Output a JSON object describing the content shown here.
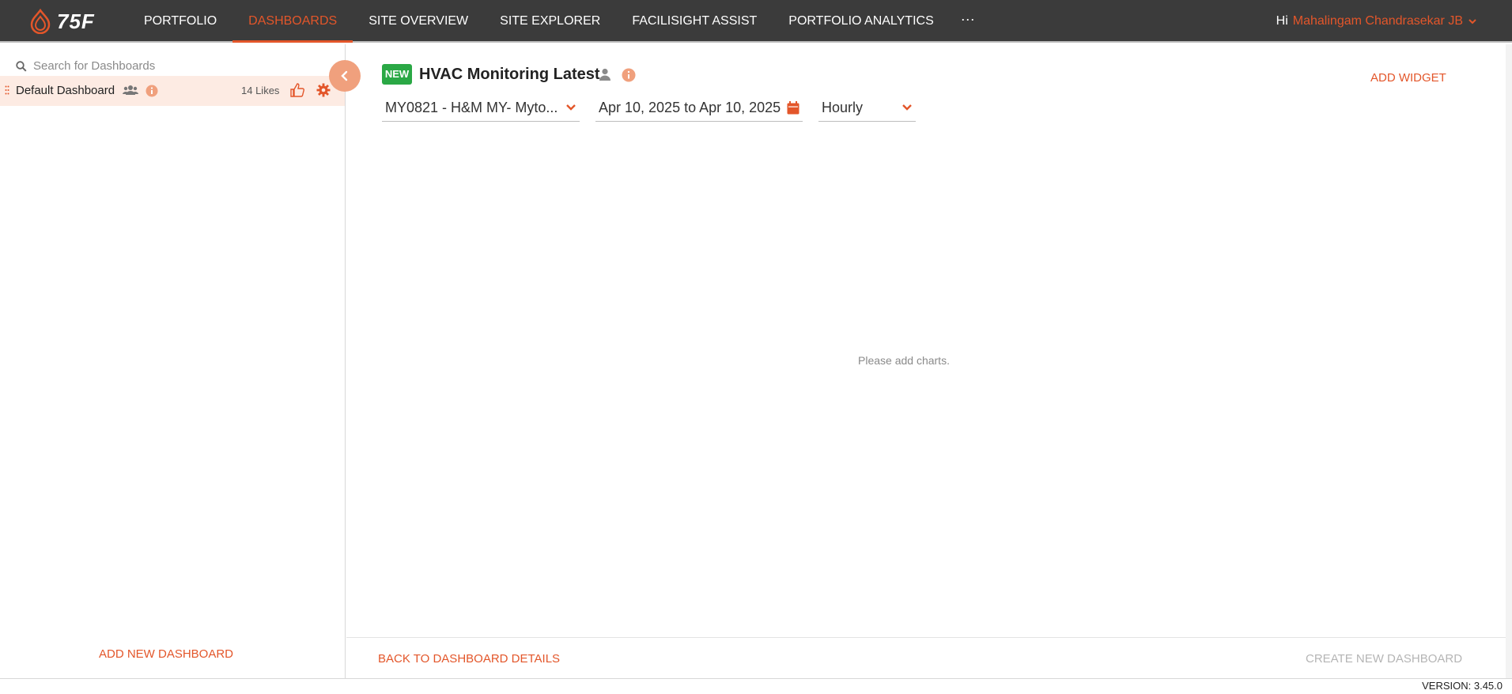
{
  "header": {
    "logo_text": "75F",
    "nav": [
      {
        "label": "PORTFOLIO",
        "active": false
      },
      {
        "label": "DASHBOARDS",
        "active": true
      },
      {
        "label": "SITE OVERVIEW",
        "active": false
      },
      {
        "label": "SITE EXPLORER",
        "active": false
      },
      {
        "label": "FACILISIGHT ASSIST",
        "active": false
      },
      {
        "label": "PORTFOLIO ANALYTICS",
        "active": false
      }
    ],
    "more_label": "···",
    "greeting": "Hi",
    "user_name": "Mahalingam Chandrasekar JB"
  },
  "sidebar": {
    "search_placeholder": "Search for Dashboards",
    "dashboards": [
      {
        "name": "Default Dashboard",
        "likes": "14 Likes"
      }
    ],
    "add_new_label": "ADD NEW DASHBOARD"
  },
  "main": {
    "badge": "NEW",
    "title": "HVAC Monitoring Latest",
    "add_widget_label": "ADD WIDGET",
    "site_select": "MY0821 - H&M MY- Myto...",
    "date_range": "Apr 10, 2025 to Apr 10, 2025",
    "interval": "Hourly",
    "empty_message": "Please add charts.",
    "back_label": "BACK TO DASHBOARD DETAILS",
    "create_label": "CREATE NEW DASHBOARD"
  },
  "footer": {
    "version": "VERSION: 3.45.0"
  },
  "colors": {
    "accent": "#e3562a",
    "topbar": "#3b3b3b",
    "selected_row": "#fdebe3",
    "new_badge": "#2aa845"
  }
}
